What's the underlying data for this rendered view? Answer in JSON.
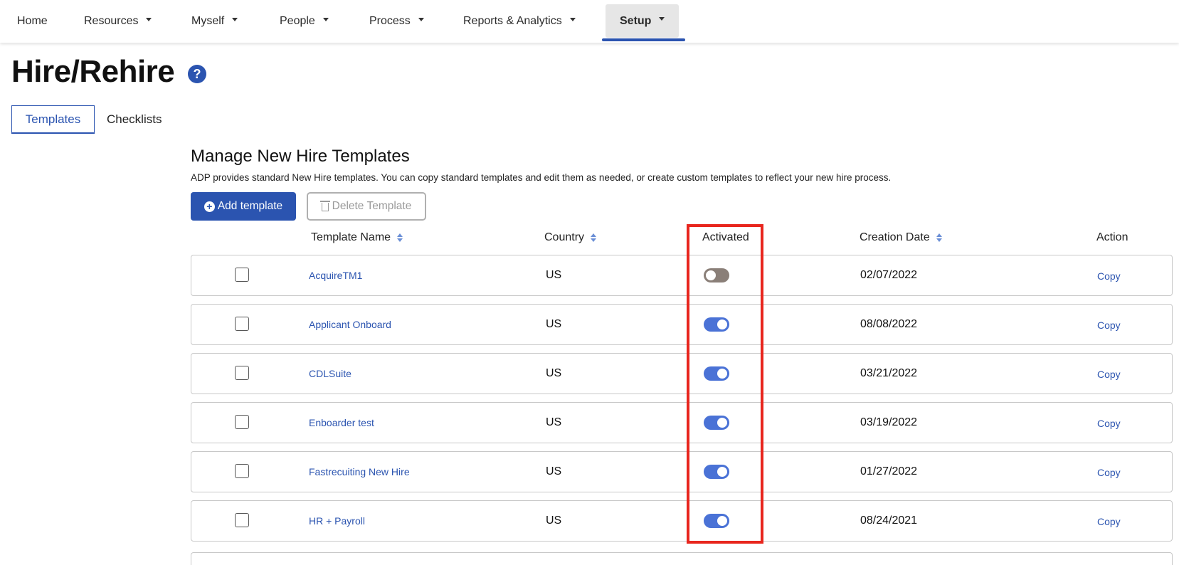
{
  "nav": {
    "items": [
      {
        "label": "Home",
        "dropdown": false
      },
      {
        "label": "Resources",
        "dropdown": true
      },
      {
        "label": "Myself",
        "dropdown": true
      },
      {
        "label": "People",
        "dropdown": true
      },
      {
        "label": "Process",
        "dropdown": true
      },
      {
        "label": "Reports & Analytics",
        "dropdown": true
      },
      {
        "label": "Setup",
        "dropdown": true,
        "active": true
      }
    ]
  },
  "page": {
    "title": "Hire/Rehire",
    "help_glyph": "?"
  },
  "tabs": [
    {
      "label": "Templates",
      "active": true
    },
    {
      "label": "Checklists",
      "active": false
    }
  ],
  "section": {
    "title": "Manage New Hire Templates",
    "description": "ADP provides standard New Hire templates. You can copy standard templates and edit them as needed, or create custom templates to reflect your new hire process."
  },
  "buttons": {
    "add_label": "Add template",
    "add_glyph": "+",
    "delete_label": "Delete Template"
  },
  "table": {
    "headers": {
      "template_name": "Template Name",
      "country": "Country",
      "activated": "Activated",
      "creation_date": "Creation Date",
      "action": "Action"
    },
    "rows": [
      {
        "name": "AcquireTM1",
        "country": "US",
        "activated": false,
        "date": "02/07/2022",
        "action": "Copy"
      },
      {
        "name": "Applicant Onboard",
        "country": "US",
        "activated": true,
        "date": "08/08/2022",
        "action": "Copy"
      },
      {
        "name": "CDLSuite",
        "country": "US",
        "activated": true,
        "date": "03/21/2022",
        "action": "Copy"
      },
      {
        "name": "Enboarder test",
        "country": "US",
        "activated": true,
        "date": "03/19/2022",
        "action": "Copy"
      },
      {
        "name": "Fastrecuiting New Hire",
        "country": "US",
        "activated": true,
        "date": "01/27/2022",
        "action": "Copy"
      },
      {
        "name": "HR + Payroll",
        "country": "US",
        "activated": true,
        "date": "08/24/2021",
        "action": "Copy"
      }
    ]
  },
  "colors": {
    "accent": "#2b54b0",
    "toggle_on": "#4a72d6",
    "toggle_off": "#8a7f78",
    "highlight": "#e8261e"
  }
}
